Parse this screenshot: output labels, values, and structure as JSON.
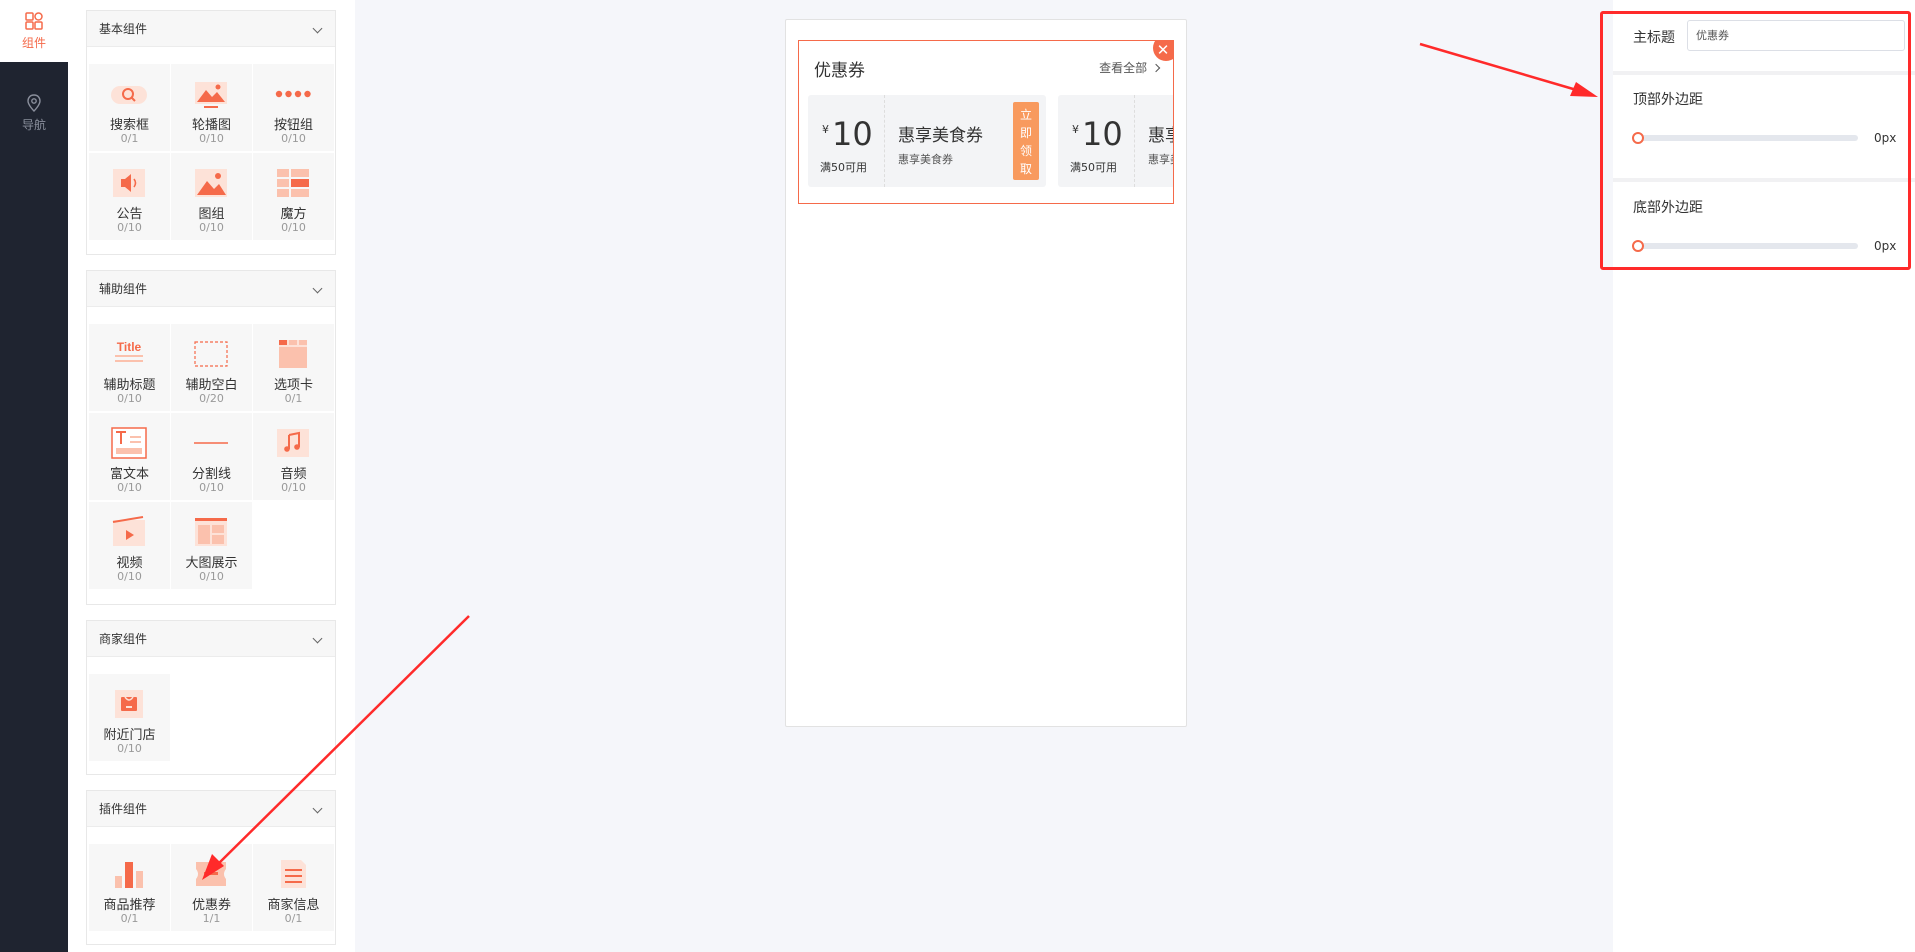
{
  "nav": {
    "items": [
      {
        "label": "组件",
        "icon": "components-icon",
        "active": true
      },
      {
        "label": "导航",
        "icon": "location-pin-icon",
        "active": false
      }
    ]
  },
  "library": {
    "groups": [
      {
        "title": "基本组件",
        "items": [
          {
            "name": "搜索框",
            "count": "0/1",
            "icon": "search-box-icon"
          },
          {
            "name": "轮播图",
            "count": "0/10",
            "icon": "carousel-icon"
          },
          {
            "name": "按钮组",
            "count": "0/10",
            "icon": "button-group-icon"
          },
          {
            "name": "公告",
            "count": "0/10",
            "icon": "announcement-icon"
          },
          {
            "name": "图组",
            "count": "0/10",
            "icon": "image-group-icon"
          },
          {
            "name": "魔方",
            "count": "0/10",
            "icon": "cube-layout-icon"
          }
        ]
      },
      {
        "title": "辅助组件",
        "items": [
          {
            "name": "辅助标题",
            "count": "0/10",
            "icon": "title-icon",
            "icon_text": "Title"
          },
          {
            "name": "辅助空白",
            "count": "0/20",
            "icon": "blank-space-icon"
          },
          {
            "name": "选项卡",
            "count": "0/1",
            "icon": "tab-card-icon"
          },
          {
            "name": "富文本",
            "count": "0/10",
            "icon": "rich-text-icon"
          },
          {
            "name": "分割线",
            "count": "0/10",
            "icon": "divider-line-icon"
          },
          {
            "name": "音频",
            "count": "0/10",
            "icon": "audio-icon"
          },
          {
            "name": "视频",
            "count": "0/10",
            "icon": "video-icon"
          },
          {
            "name": "大图展示",
            "count": "0/10",
            "icon": "big-image-icon"
          }
        ]
      },
      {
        "title": "商家组件",
        "items": [
          {
            "name": "附近门店",
            "count": "0/10",
            "icon": "store-icon"
          }
        ]
      },
      {
        "title": "插件组件",
        "items": [
          {
            "name": "商品推荐",
            "count": "0/1",
            "icon": "bar-chart-icon"
          },
          {
            "name": "优惠券",
            "count": "1/1",
            "icon": "coupon-icon"
          },
          {
            "name": "商家信息",
            "count": "0/1",
            "icon": "merchant-info-icon"
          }
        ]
      }
    ]
  },
  "preview": {
    "coupon_title": "优惠券",
    "view_all": "查看全部",
    "coupons": [
      {
        "currency": "¥",
        "amount": "10",
        "condition": "满50可用",
        "name": "惠享美食券",
        "desc": "惠享美食券",
        "action": [
          "立",
          "即",
          "领",
          "取"
        ]
      },
      {
        "currency": "¥",
        "amount": "10",
        "condition": "满50可用",
        "name": "惠享美食券",
        "desc": "惠享美食券"
      }
    ]
  },
  "properties": {
    "main_title_label": "主标题",
    "main_title_value": "优惠券",
    "top_margin_label": "顶部外边距",
    "top_margin_value": "0px",
    "top_margin_level": 0,
    "bottom_margin_label": "底部外边距",
    "bottom_margin_value": "0px",
    "bottom_margin_level": 0
  },
  "colors": {
    "accent": "#f56a4a",
    "nav_bg": "#1f2430",
    "annotation_red": "#ff2a2a"
  }
}
